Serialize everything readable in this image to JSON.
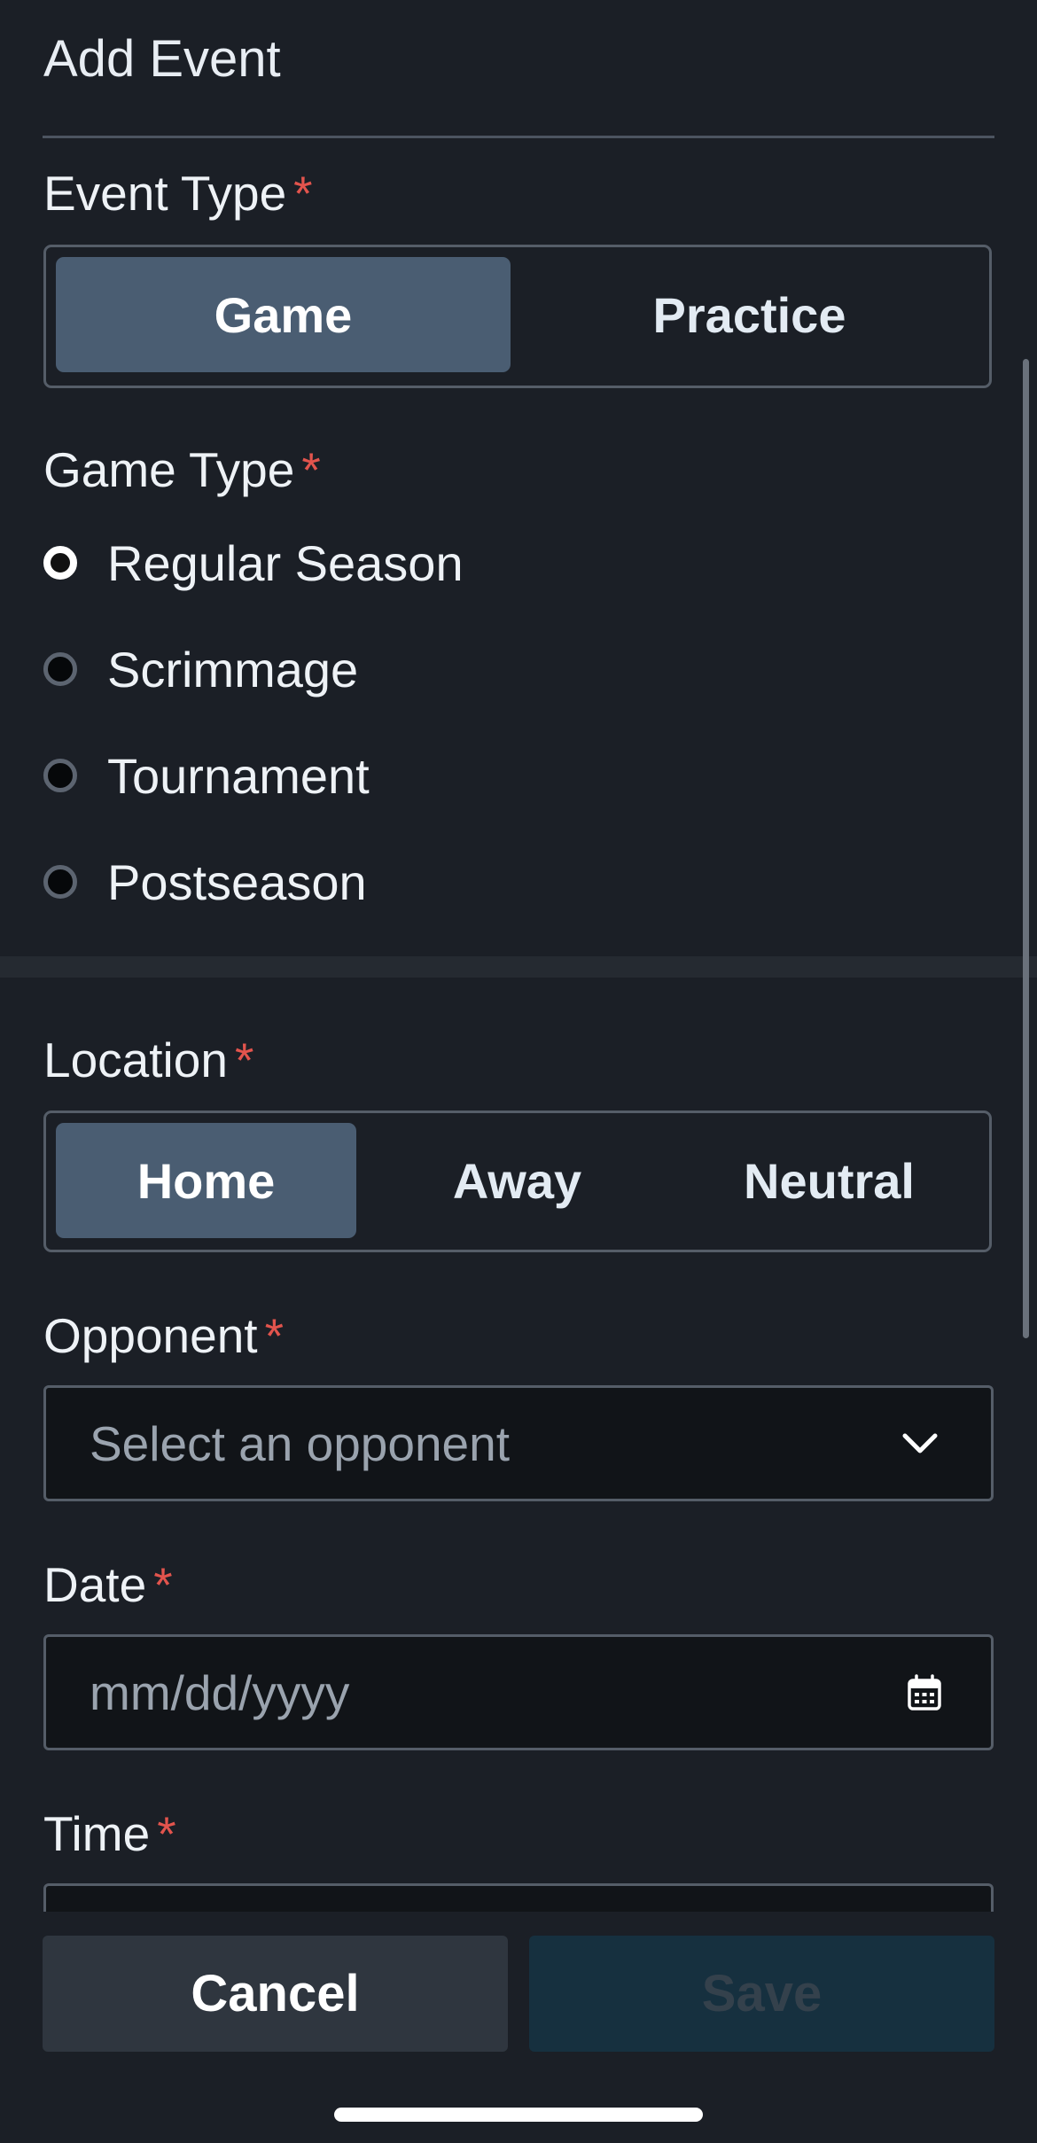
{
  "title": "Add Event",
  "required_marker": "*",
  "event_type": {
    "label": "Event Type",
    "options": [
      "Game",
      "Practice"
    ],
    "selected": "Game"
  },
  "game_type": {
    "label": "Game Type",
    "options": [
      "Regular Season",
      "Scrimmage",
      "Tournament",
      "Postseason"
    ],
    "selected": "Regular Season"
  },
  "location": {
    "label": "Location",
    "options": [
      "Home",
      "Away",
      "Neutral"
    ],
    "selected": "Home"
  },
  "opponent": {
    "label": "Opponent",
    "placeholder": "Select an opponent",
    "icon": "chevron-down-icon"
  },
  "date": {
    "label": "Date",
    "placeholder": "mm/dd/yyyy",
    "icon": "calendar-icon"
  },
  "time": {
    "label": "Time"
  },
  "footer": {
    "cancel_label": "Cancel",
    "save_label": "Save"
  },
  "colors": {
    "background": "#1b1f26",
    "segment_active": "#4a5d72",
    "required": "#e2544d",
    "save_disabled_bg": "#16303f",
    "cancel_bg": "#2f363f"
  }
}
